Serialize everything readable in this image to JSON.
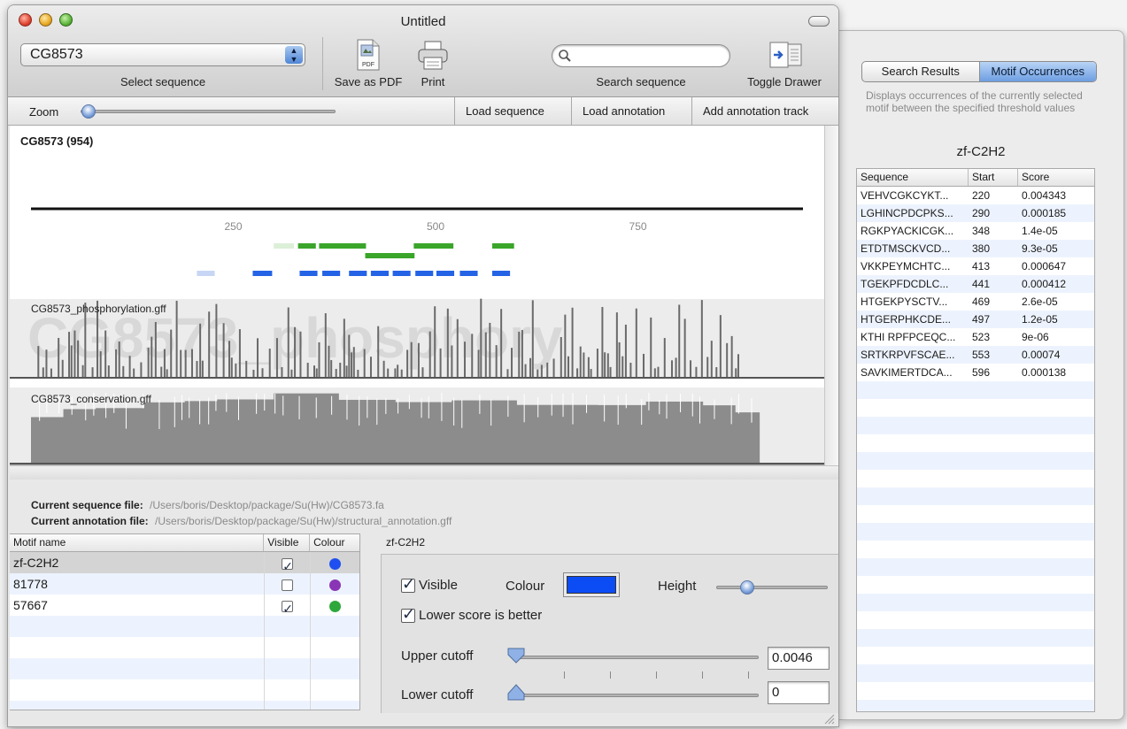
{
  "window": {
    "title": "Untitled"
  },
  "toolbar": {
    "sequence_value": "CG8573",
    "select_sequence_label": "Select sequence",
    "save_pdf_label": "Save as PDF",
    "pdf_icon_text": "PDF",
    "print_label": "Print",
    "search_label": "Search sequence",
    "search_value": "",
    "toggle_drawer_label": "Toggle Drawer"
  },
  "actionbar": {
    "zoom_label": "Zoom",
    "zoom_level": 0.03,
    "load_sequence": "Load sequence",
    "load_annotation": "Load annotation",
    "add_track": "Add annotation track"
  },
  "sequence_view": {
    "name": "CG8573 (954)",
    "length": 954,
    "ruler_ticks": [
      "250",
      "500",
      "750"
    ],
    "ruler_tick_positions": [
      250,
      500,
      750
    ],
    "tracks": [
      {
        "label": "CG8573_phosphorylation.gff",
        "watermark": "CG8573_phosphory"
      },
      {
        "label": "CG8573_conservation.gff",
        "watermark": ""
      }
    ],
    "motif_colors": {
      "green": "#3aa52a",
      "blue": "#2563e6",
      "light_blue": "#c8d6f5",
      "light_green": "#dcefd8"
    }
  },
  "files": {
    "sequence_label": "Current sequence file:",
    "sequence_path": "/Users/boris/Desktop/package/Su(Hw)/CG8573.fa",
    "annotation_label": "Current annotation file:",
    "annotation_path": "/Users/boris/Desktop/package/Su(Hw)/structural_annotation.gff"
  },
  "motif_table": {
    "headers": [
      "Motif name",
      "Visible",
      "Colour"
    ],
    "rows": [
      {
        "name": "zf-C2H2",
        "visible": true,
        "colour": "#1f4ff0",
        "selected": true
      },
      {
        "name": "81778",
        "visible": false,
        "colour": "#8a35b5",
        "selected": false
      },
      {
        "name": "57667",
        "visible": true,
        "colour": "#2ea83b",
        "selected": false
      }
    ]
  },
  "detail": {
    "title": "zf-C2H2",
    "visible_label": "Visible",
    "visible_checked": true,
    "colour_label": "Colour",
    "colour_value": "#0b4cf5",
    "height_label": "Height",
    "height_level": 0.28,
    "lower_better_label": "Lower score is better",
    "lower_better_checked": true,
    "upper_cutoff_label": "Upper cutoff",
    "upper_cutoff_value": "0.0046",
    "lower_cutoff_label": "Lower cutoff",
    "lower_cutoff_value": "0"
  },
  "drawer": {
    "tab_search": "Search Results",
    "tab_occurrences": "Motif Occurrences",
    "description": "Displays occurrences of the currently selected motif between the specified threshold values",
    "motif_title": "zf-C2H2",
    "headers": [
      "Sequence",
      "Start",
      "Score"
    ],
    "rows": [
      {
        "sequence": "VEHVCGKCYKT...",
        "start": "220",
        "score": "0.004343"
      },
      {
        "sequence": "LGHINCPDCPKS...",
        "start": "290",
        "score": "0.000185"
      },
      {
        "sequence": "RGKPYACKICGK...",
        "start": "348",
        "score": "1.4e-05"
      },
      {
        "sequence": "ETDTMSCKVCD...",
        "start": "380",
        "score": "9.3e-05"
      },
      {
        "sequence": "VKKPEYMCHTC...",
        "start": "413",
        "score": "0.000647"
      },
      {
        "sequence": "TGEKPFDCDLC...",
        "start": "441",
        "score": "0.000412"
      },
      {
        "sequence": "HTGEKPYSCTV...",
        "start": "469",
        "score": "2.6e-05"
      },
      {
        "sequence": "HTGERPHKCDE...",
        "start": "497",
        "score": "1.2e-05"
      },
      {
        "sequence": "KTHI RPFPCEQC...",
        "start": "523",
        "score": "9e-06"
      },
      {
        "sequence": "SRTKRPVFSCAE...",
        "start": "553",
        "score": "0.00074"
      },
      {
        "sequence": "SAVKIMERTDCA...",
        "start": "596",
        "score": "0.000138"
      }
    ]
  }
}
